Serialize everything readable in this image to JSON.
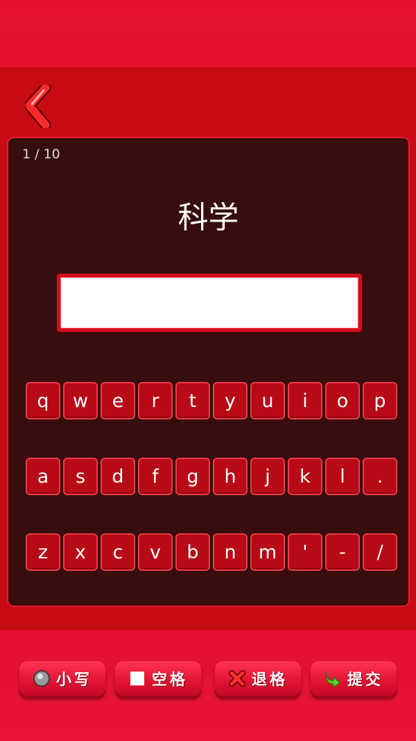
{
  "header": {
    "back_icon": "chevron-left-icon"
  },
  "quiz": {
    "progress": "1 / 10",
    "word": "科学",
    "answer_value": ""
  },
  "keyboard": {
    "rows": [
      [
        "q",
        "w",
        "e",
        "r",
        "t",
        "y",
        "u",
        "i",
        "o",
        "p"
      ],
      [
        "a",
        "s",
        "d",
        "f",
        "g",
        "h",
        "j",
        "k",
        "l",
        "."
      ],
      [
        "z",
        "x",
        "c",
        "v",
        "b",
        "n",
        "m",
        "'",
        "-",
        "/"
      ]
    ]
  },
  "actions": {
    "lowercase_label": "小写",
    "space_label": "空格",
    "backspace_label": "退格",
    "submit_label": "提交",
    "lowercase_icon": "radio-circle-icon",
    "space_icon": "square-icon",
    "backspace_icon": "x-mark-icon",
    "submit_icon": "arrow-right-icon"
  },
  "colors": {
    "background": "#e8102f",
    "panel": "#380d0d",
    "key": "#b80a16",
    "accent_green": "#5fd32a"
  }
}
